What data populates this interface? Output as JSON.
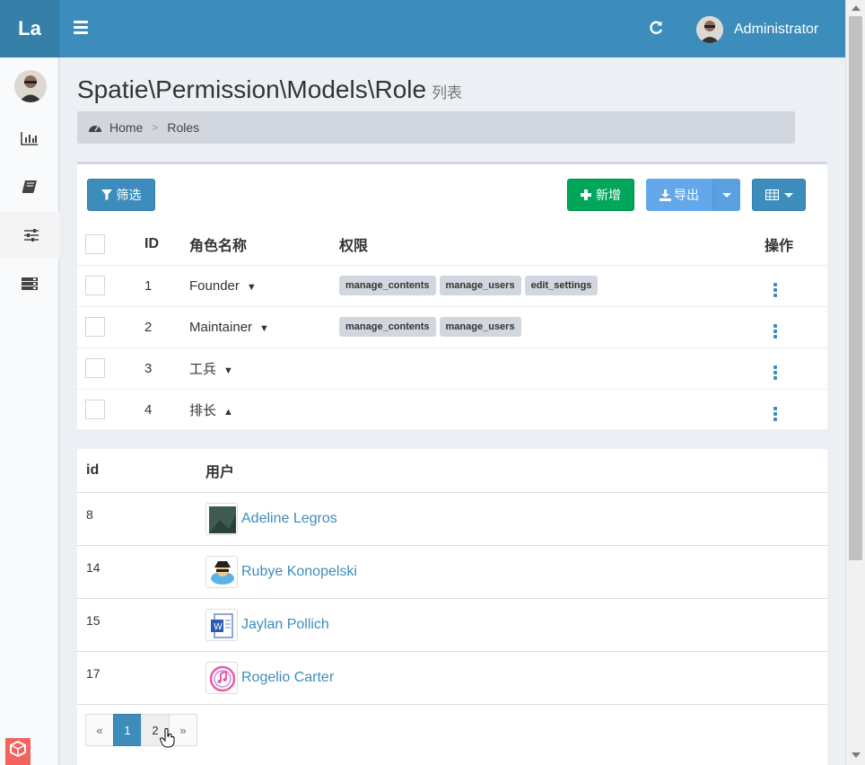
{
  "header": {
    "logo": "La",
    "user_name": "Administrator"
  },
  "page": {
    "title": "Spatie\\Permission\\Models\\Role",
    "subtitle": "列表"
  },
  "breadcrumb": {
    "home": "Home",
    "current": "Roles"
  },
  "toolbar": {
    "filter": "筛选",
    "new": "新增",
    "export": "导出"
  },
  "roles_table": {
    "headers": {
      "id": "ID",
      "name": "角色名称",
      "permissions": "权限",
      "actions": "操作"
    },
    "rows": [
      {
        "id": "1",
        "name": "Founder",
        "expanded": false,
        "permissions": [
          "manage_contents",
          "manage_users",
          "edit_settings"
        ]
      },
      {
        "id": "2",
        "name": "Maintainer",
        "expanded": false,
        "permissions": [
          "manage_contents",
          "manage_users"
        ]
      },
      {
        "id": "3",
        "name": "工兵",
        "expanded": false,
        "permissions": []
      },
      {
        "id": "4",
        "name": "排长",
        "expanded": true,
        "permissions": []
      }
    ]
  },
  "users_table": {
    "headers": {
      "id": "id",
      "user": "用户"
    },
    "rows": [
      {
        "id": "8",
        "name": "Adeline Legros"
      },
      {
        "id": "14",
        "name": "Rubye Konopelski"
      },
      {
        "id": "15",
        "name": "Jaylan Pollich"
      },
      {
        "id": "17",
        "name": "Rogelio Carter"
      }
    ]
  },
  "pagination": {
    "prev": "«",
    "pages": [
      "1",
      "2"
    ],
    "current": "1",
    "next": "»"
  },
  "colors": {
    "header": "#3c8dbc",
    "logo_bg": "#367fa9",
    "success": "#00a65a",
    "export": "#62a8ea",
    "link": "#3c8dbc"
  }
}
